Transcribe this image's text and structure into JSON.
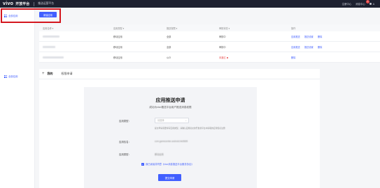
{
  "topbar": {
    "brand": "vivo",
    "platform": "开放平台",
    "product": "推送运营平台",
    "links": [
      "注册中心",
      "消息中心"
    ],
    "message_count": "1",
    "user": "A"
  },
  "app_selector": {
    "label": "全部应用"
  },
  "new_app_button": "新建应用",
  "table": {
    "headers": [
      "应用名称",
      "应用类型",
      "推送权限",
      "审核状态",
      "操作"
    ],
    "rows": [
      {
        "type": "移动应用",
        "perm": "全部",
        "status": "审核中",
        "actions": [
          "应用推送",
          "推送设置",
          "删除"
        ]
      },
      {
        "type": "移动应用",
        "perm": "全部",
        "status": "审核中",
        "actions": [
          "应用推送",
          "推送设置",
          "删除"
        ]
      },
      {
        "type": "移动应用",
        "perm": "公众",
        "status": "未通过",
        "actions": [
          "删除"
        ]
      }
    ]
  },
  "sidebar2": {
    "label": "全部应用"
  },
  "panel": {
    "tab_active": "我的",
    "tab": "权限申请"
  },
  "form": {
    "title": "应用推送申请",
    "subtitle": "成功为vivo推送平台用户推送消息权限",
    "field1_label": "应用类型：",
    "field1_placeholder": "请选择",
    "field1_hint": "提交申请需要填写应用类型，请确认应用提交的开发者平台中获取的应用包名注册",
    "field2_label": "应用包名：",
    "field2_value": "com.gamecenter.android.ble5665",
    "field3_label": "应用类型：",
    "field3_value": "移动应用",
    "agree_text": "我已阅读并同意《vivo消息推送平台服务协议》",
    "submit": "提交申请"
  },
  "colors": {
    "accent": "#415fff",
    "topbar": "#1e2130",
    "highlight": "#d4161e",
    "danger": "#e84a4a"
  }
}
